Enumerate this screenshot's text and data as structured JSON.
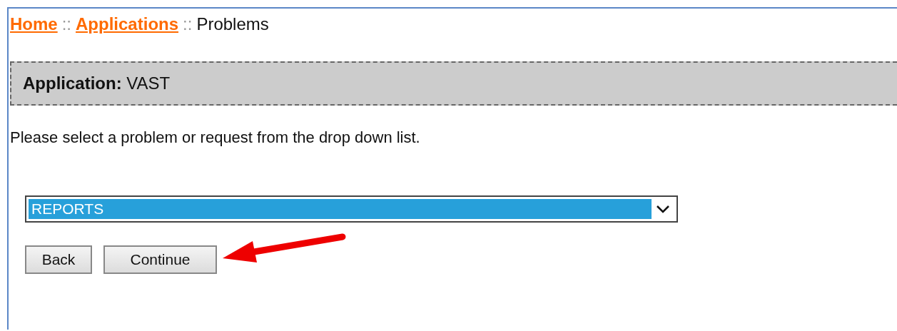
{
  "breadcrumb": [
    {
      "label": "Home",
      "kind": "link"
    },
    {
      "label": "::",
      "kind": "separator"
    },
    {
      "label": "Applications",
      "kind": "link"
    },
    {
      "label": "::",
      "kind": "separator"
    },
    {
      "label": "Problems",
      "kind": "current"
    }
  ],
  "application": {
    "label": "Application:",
    "value": "VAST"
  },
  "instruction": "Please select a problem or request from the drop down list.",
  "dropdown": {
    "value": "REPORTS",
    "selected": true
  },
  "buttons": [
    "Back",
    "Continue"
  ]
}
